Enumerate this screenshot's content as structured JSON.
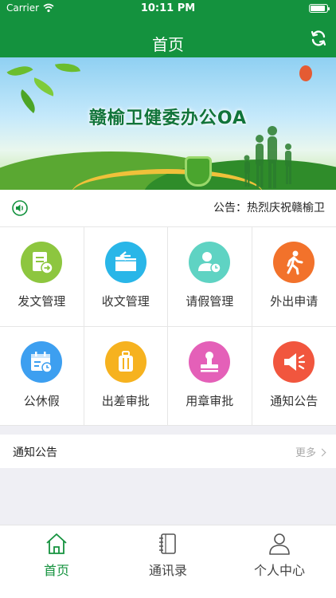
{
  "status_bar": {
    "carrier": "Carrier",
    "time": "10:11 PM",
    "battery_percent": 90
  },
  "nav": {
    "title": "首页",
    "refresh_icon": "refresh-icon"
  },
  "banner": {
    "title": "赣榆卫健委办公OA"
  },
  "notice_bar": {
    "icon": "speaker-icon",
    "text": "公告：热烈庆祝赣榆卫"
  },
  "grid": {
    "items": [
      {
        "label": "发文管理",
        "icon": "send-document-icon",
        "color": "#8dc63f"
      },
      {
        "label": "收文管理",
        "icon": "receive-folder-icon",
        "color": "#29b6e8"
      },
      {
        "label": "请假管理",
        "icon": "leave-user-clock-icon",
        "color": "#5fd3c3"
      },
      {
        "label": "外出申请",
        "icon": "walking-person-icon",
        "color": "#f2722b"
      },
      {
        "label": "公休假",
        "icon": "calendar-clock-icon",
        "color": "#3d9ff0"
      },
      {
        "label": "出差审批",
        "icon": "luggage-icon",
        "color": "#f6b21f"
      },
      {
        "label": "用章审批",
        "icon": "stamp-icon",
        "color": "#e460b8"
      },
      {
        "label": "通知公告",
        "icon": "megaphone-icon",
        "color": "#f1563e"
      }
    ]
  },
  "notice_section": {
    "title": "通知公告",
    "more_label": "更多"
  },
  "tabbar": {
    "tabs": [
      {
        "label": "首页",
        "icon": "home-icon",
        "active": true
      },
      {
        "label": "通讯录",
        "icon": "address-book-icon",
        "active": false
      },
      {
        "label": "个人中心",
        "icon": "person-icon",
        "active": false
      }
    ]
  },
  "colors": {
    "brand": "#14923e",
    "background": "#efeff4",
    "inactive": "#444444"
  }
}
